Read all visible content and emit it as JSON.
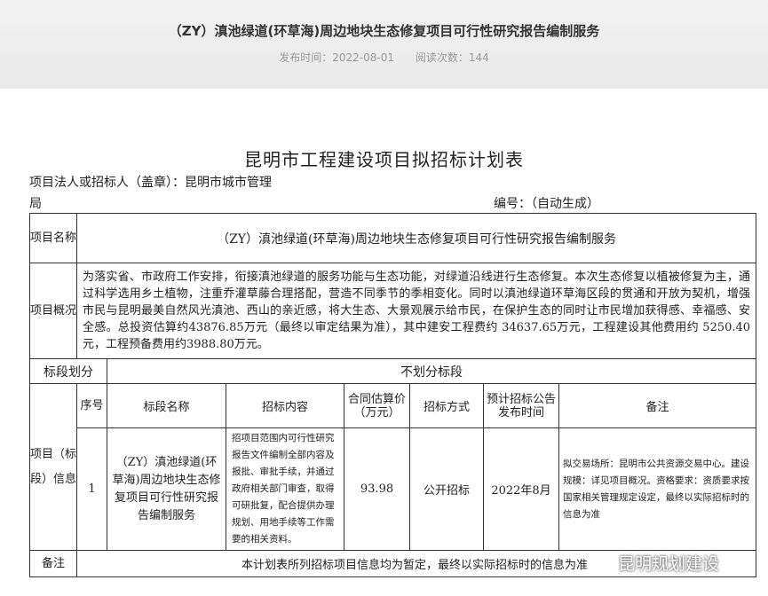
{
  "article": {
    "title": "（ZY）滇池绿道(环草海)周边地块生态修复项目可行性研究报告编制服务",
    "publish_label": "发布时间：2022-08-01",
    "views_label": "阅读次数：144"
  },
  "doc": {
    "title": "昆明市工程建设项目拟招标计划表",
    "owner_line1": "项目法人或招标人（盖章）：昆明市城市管理",
    "owner_line2": "局",
    "serial": "编号：（自动生成）"
  },
  "table": {
    "name_label": "项目名称",
    "name_value": "（ZY）滇池绿道(环草海)周边地块生态修复项目可行性研究报告编制服务",
    "overview_label": "项目概况",
    "overview_text": "为落实省、市政府工作安排，衔接滇池绿道的服务功能与生态功能，对绿道沿线进行生态修复。本次生态修复以植被修复为主，通过科学选用乡土植物，注重乔灌草藤合理搭配，营造不同季节的季相变化。同时以滇池绿道环草海区段的贯通和开放为契机，增强市民与昆明最美自然风光滇池、西山的亲近感，将大生态、大景观展示给市民，在保护生态的同时让市民增加获得感、幸福感、安全感。总投资估算约43876.85万元（最终以审定结果为准），其中建安工程费约 34637.65万元，工程建设其他费用约 5250.40元，工程预备费用约3988.80万元。",
    "division_label": "标段划分",
    "division_value": "不划分标段",
    "info_label": "项目（标段）信息",
    "headers": {
      "seq": "序号",
      "name": "标段名称",
      "content": "招标内容",
      "price": "合同估算价（万元）",
      "method": "招标方式",
      "date": "预计招标公告发布时间",
      "remark": "备注"
    },
    "row": {
      "seq": "1",
      "name": "（ZY）滇池绿道(环草海)周边地块生态修复项目可行性研究报告编制服务",
      "content": "招项目范围内可行性研究报告文件编制全部内容及报批、审批手续，并通过政府相关部门审查，取得可研批复，配合提供办理规划、用地手续等工作需要的相关资料。",
      "price": "93.98",
      "method": "公开招标",
      "date": "2022年8月",
      "remark": "拟交易场所：昆明市公共资源交易中心。建设规模：详见项目概况。资格要求：资质要求按国家相关管理规定设定，最终以实际招标时的信息为准"
    },
    "note_label": "备注",
    "note_text": "本计划表所列招标项目信息均为暂定，最终以实际招标时的信息为准"
  },
  "watermark": "昆明规划建设"
}
